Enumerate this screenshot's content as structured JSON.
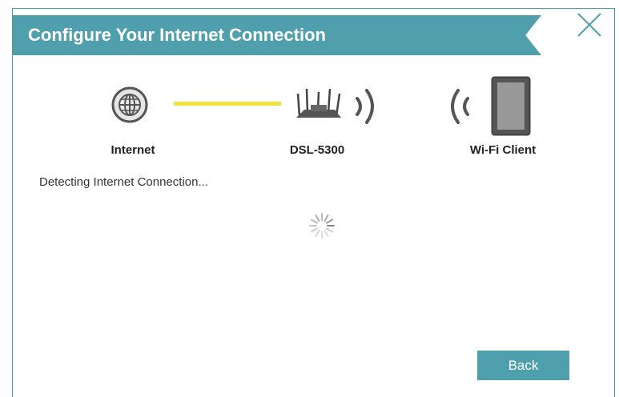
{
  "dialog": {
    "title": "Configure Your Internet Connection",
    "close_icon": "close-icon"
  },
  "diagram": {
    "nodes": [
      {
        "label": "Internet",
        "icon": "globe-icon"
      },
      {
        "label": "DSL-5300",
        "icon": "router-icon"
      },
      {
        "label": "Wi-Fi Client",
        "icon": "tablet-icon"
      }
    ],
    "link_color": "#f2e33a"
  },
  "status": {
    "message": "Detecting Internet Connection..."
  },
  "actions": {
    "back_label": "Back"
  },
  "colors": {
    "accent": "#4f9fad",
    "link": "#f2e33a",
    "icon_gray": "#555555"
  }
}
